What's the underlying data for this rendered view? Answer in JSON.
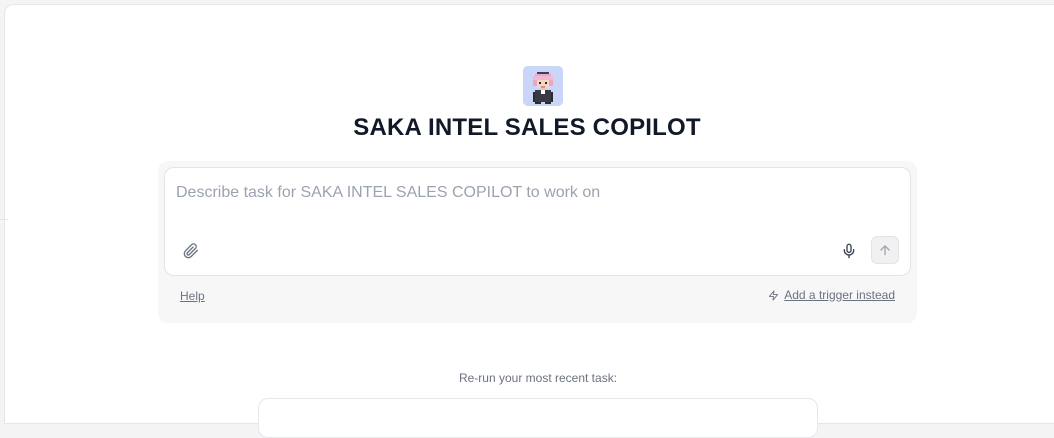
{
  "agent": {
    "name": "SAKA INTEL SALES COPILOT",
    "avatar_icon": "pixel-character-avatar",
    "avatar_bg": "#c9d6f7"
  },
  "composer": {
    "placeholder": "Describe task for SAKA INTEL SALES COPILOT to work on",
    "value": "",
    "attach_icon": "paperclip-icon",
    "mic_icon": "microphone-icon",
    "send_icon": "arrow-up-icon"
  },
  "footer": {
    "help_label": "Help",
    "trigger_icon": "lightning-icon",
    "trigger_label": "Add a trigger instead"
  },
  "recent": {
    "label": "Re-run your most recent task:"
  }
}
